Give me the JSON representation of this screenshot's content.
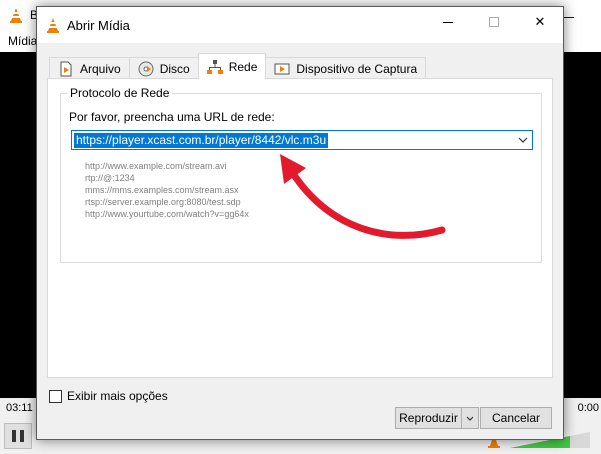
{
  "background_app": {
    "title_stub": "B",
    "menu_stub": "Mídia",
    "time_elapsed": "03:11",
    "time_total": "0:00"
  },
  "dialog": {
    "title": "Abrir Mídia",
    "tabs": [
      {
        "label": "Arquivo",
        "icon": "file-icon",
        "active": false
      },
      {
        "label": "Disco",
        "icon": "disc-icon",
        "active": false
      },
      {
        "label": "Rede",
        "icon": "network-icon",
        "active": true
      },
      {
        "label": "Dispositivo de Captura",
        "icon": "capture-device-icon",
        "active": false
      }
    ],
    "group_title": "Protocolo de Rede",
    "url_label": "Por favor, preencha uma URL de rede:",
    "url_value": "https://player.xcast.com.br/player/8442/vlc.m3u",
    "examples": [
      "http://www.example.com/stream.avi",
      "rtp://@:1234",
      "mms://mms.examples.com/stream.asx",
      "rtsp://server.example.org:8080/test.sdp",
      "http://www.yourtube.com/watch?v=gg64x"
    ],
    "more_options_label": "Exibir mais opções",
    "more_options_checked": false,
    "play_button": "Reproduzir",
    "cancel_button": "Cancelar"
  },
  "colors": {
    "accent": "#0078d7",
    "annotation_arrow": "#e21a2c",
    "vlc_orange": "#f08000"
  }
}
